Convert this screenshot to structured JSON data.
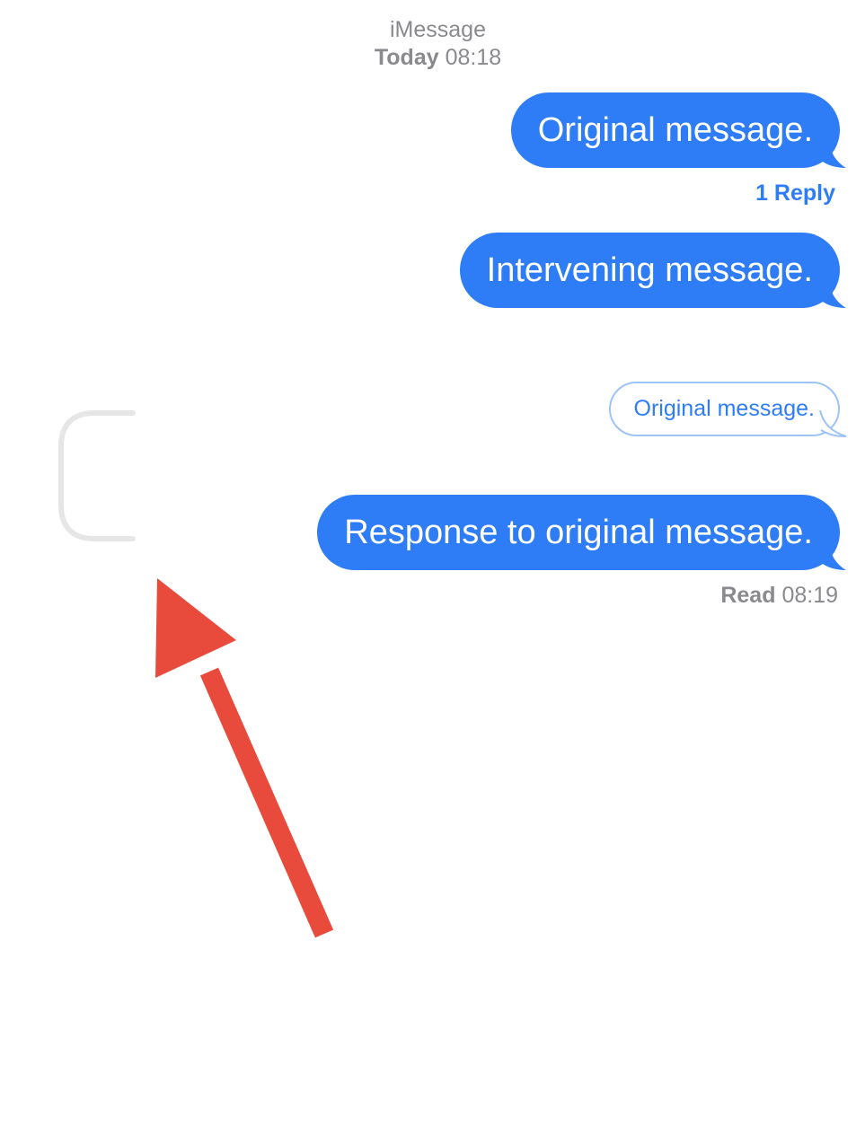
{
  "conversation": {
    "service": "iMessage",
    "date_label": "Today",
    "time": "08:18"
  },
  "messages": [
    {
      "text": "Original message.",
      "from": "me"
    },
    {
      "text": "Intervening message.",
      "from": "me"
    },
    {
      "text": "Response to original message.",
      "from": "me",
      "quoted_text": "Original message."
    }
  ],
  "thread": {
    "reply_label": "1 Reply"
  },
  "read_receipt": {
    "label": "Read",
    "time": "08:19"
  },
  "colors": {
    "bubble": "#2f7df6",
    "bubble_text": "#ffffff",
    "meta_text": "#8a8a8e",
    "quote_border": "#9cc4f7",
    "bracket": "#e6e6e6",
    "arrow": "#e84b3c"
  },
  "icons": {
    "annotation": "red-arrow-icon",
    "thread_line": "reply-thread-bracket"
  }
}
